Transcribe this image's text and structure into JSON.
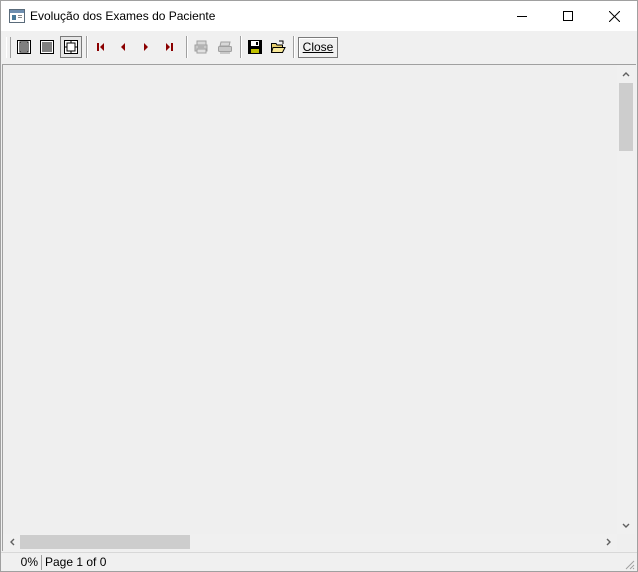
{
  "window": {
    "title": "Evolução dos Exames do Paciente"
  },
  "toolbar": {
    "buttons": [
      {
        "name": "whole-page",
        "icon": "whole-page-icon"
      },
      {
        "name": "page-width",
        "icon": "page-width-icon"
      },
      {
        "name": "zoom-100",
        "icon": "zoom-100-icon",
        "pressed": true
      },
      {
        "name": "first-page",
        "icon": "first-page-icon"
      },
      {
        "name": "previous-page",
        "icon": "previous-page-icon"
      },
      {
        "name": "next-page",
        "icon": "next-page-icon"
      },
      {
        "name": "last-page",
        "icon": "last-page-icon"
      },
      {
        "name": "printer-setup",
        "icon": "printer-setup-icon",
        "disabled": true
      },
      {
        "name": "print",
        "icon": "printer-icon",
        "disabled": true
      },
      {
        "name": "save",
        "icon": "floppy-disk-icon"
      },
      {
        "name": "open",
        "icon": "open-folder-icon"
      }
    ],
    "close_label": "Close"
  },
  "status": {
    "progress": "0%",
    "page_info": "Page 1 of 0"
  },
  "colors": {
    "nav_arrow": "#8b0000",
    "disabled": "#a0a0a0",
    "preview_bg": "#efefef",
    "scroll_thumb": "#cdcdcd"
  }
}
